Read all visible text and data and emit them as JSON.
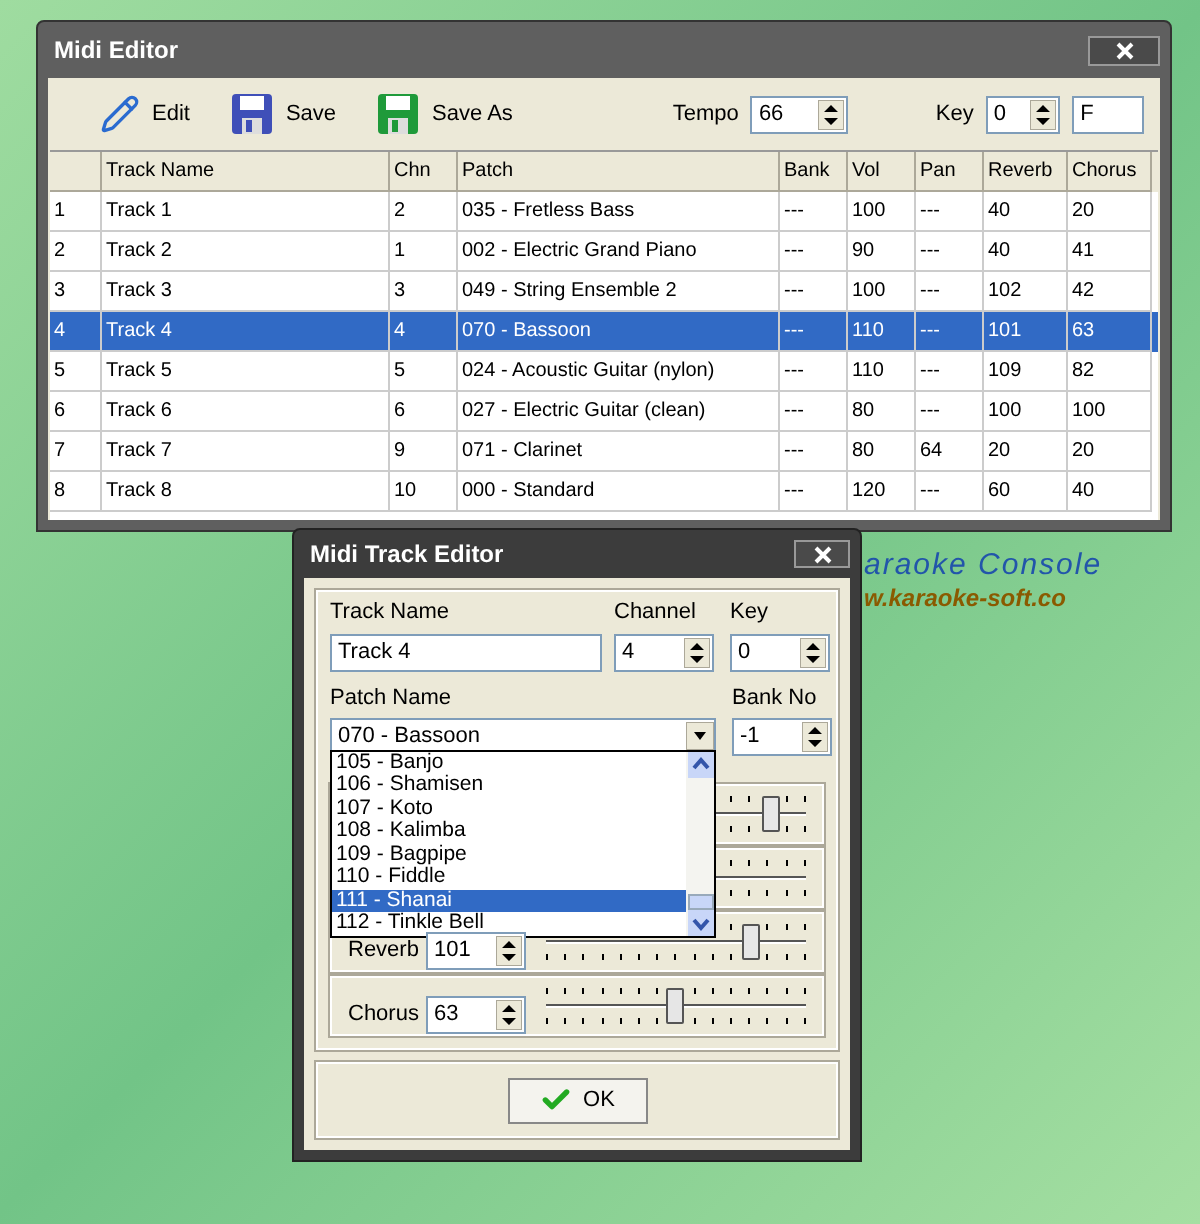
{
  "wallpaper": {
    "brand": "araoke Console",
    "url": "w.karaoke-soft.co"
  },
  "midi_editor": {
    "title": "Midi Editor",
    "toolbar": [
      {
        "label": "Edit",
        "kind": "edit"
      },
      {
        "label": "Save",
        "kind": "save"
      },
      {
        "label": "Save As",
        "kind": "save_as"
      }
    ],
    "tempo": {
      "label": "Tempo",
      "value": "66"
    },
    "key": {
      "label": "Key",
      "value": "0",
      "note": "F"
    },
    "table": {
      "columns": [
        "",
        "Track Name",
        "Chn",
        "Patch",
        "Bank",
        "Vol",
        "Pan",
        "Reverb",
        "Chorus"
      ],
      "rows": [
        {
          "selected": false,
          "cells": [
            "1",
            "Track 1",
            "2",
            "035 - Fretless Bass",
            "---",
            "100",
            "---",
            "40",
            "20"
          ]
        },
        {
          "selected": false,
          "cells": [
            "2",
            "Track 2",
            "1",
            "002 - Electric Grand Piano",
            "---",
            "90",
            "---",
            "40",
            "41"
          ]
        },
        {
          "selected": false,
          "cells": [
            "3",
            "Track 3",
            "3",
            "049 - String Ensemble 2",
            "---",
            "100",
            "---",
            "102",
            "42"
          ]
        },
        {
          "selected": true,
          "cells": [
            "4",
            "Track 4",
            "4",
            "070 - Bassoon",
            "---",
            "110",
            "---",
            "101",
            "63"
          ]
        },
        {
          "selected": false,
          "cells": [
            "5",
            "Track 5",
            "5",
            "024 - Acoustic Guitar (nylon)",
            "---",
            "110",
            "---",
            "109",
            "82"
          ]
        },
        {
          "selected": false,
          "cells": [
            "6",
            "Track 6",
            "6",
            "027 - Electric Guitar (clean)",
            "---",
            "80",
            "---",
            "100",
            "100"
          ]
        },
        {
          "selected": false,
          "cells": [
            "7",
            "Track 7",
            "9",
            "071 - Clarinet",
            "---",
            "80",
            "64",
            "20",
            "20"
          ]
        },
        {
          "selected": false,
          "cells": [
            "8",
            "Track 8",
            "10",
            "000 - Standard",
            "---",
            "120",
            "---",
            "60",
            "40"
          ]
        }
      ]
    }
  },
  "track_editor": {
    "title": "Midi Track Editor",
    "track_name": {
      "label": "Track Name",
      "value": "Track 4"
    },
    "channel": {
      "label": "Channel",
      "value": "4"
    },
    "key": {
      "label": "Key",
      "value": "0"
    },
    "patch": {
      "label": "Patch Name",
      "value": "070 - Bassoon",
      "options": [
        {
          "label": "105 - Banjo",
          "selected": false
        },
        {
          "label": "106 - Shamisen",
          "selected": false
        },
        {
          "label": "107 - Koto",
          "selected": false
        },
        {
          "label": "108 - Kalimba",
          "selected": false
        },
        {
          "label": "109 - Bagpipe",
          "selected": false
        },
        {
          "label": "110 - Fiddle",
          "selected": false
        },
        {
          "label": "111 - Shanai",
          "selected": true
        },
        {
          "label": "112 - Tinkle Bell",
          "selected": false
        }
      ]
    },
    "bank": {
      "label": "Bank No",
      "value": "-1"
    },
    "sliders": [
      {
        "kind": "slider",
        "level": 0.87
      },
      {
        "kind": "track"
      },
      {
        "kind": "slider",
        "label": "Reverb",
        "value": "101",
        "level": 0.79
      },
      {
        "kind": "slider",
        "label": "Chorus",
        "value": "63",
        "level": 0.5
      }
    ],
    "ok_button": "OK"
  }
}
